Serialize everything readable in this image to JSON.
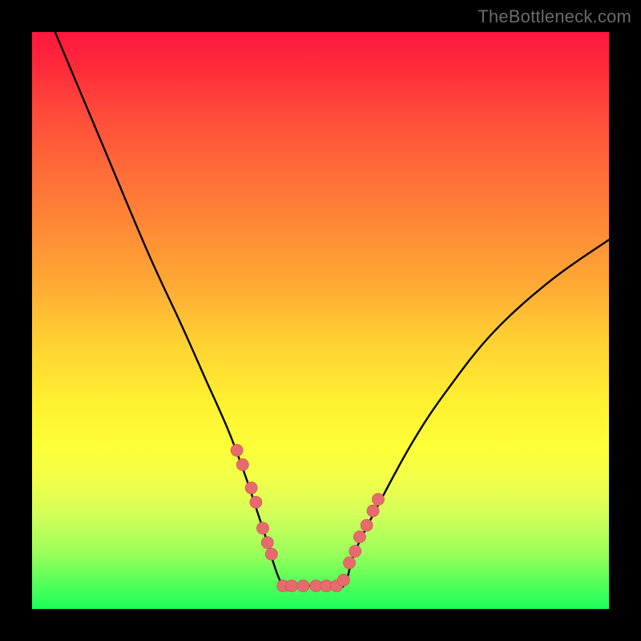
{
  "watermark": "TheBottleneck.com",
  "colors": {
    "frame": "#000000",
    "curve": "#000000",
    "dot_fill": "#e76a6e",
    "dot_stroke": "#c94f53",
    "gradient_top": "#ff173f",
    "gradient_bottom": "#1aff5a"
  },
  "chart_data": {
    "type": "line",
    "title": "",
    "xlabel": "",
    "ylabel": "",
    "xlim": [
      0,
      100
    ],
    "ylim": [
      0,
      100
    ],
    "annotations": [],
    "note": "No numeric axes are shown; x/y are normalized 0–100 within the plot area. y=0 is bottom (green), y=100 is top (red). V-shaped bottleneck curve with flat minimum and scattered dots on the flanks near the trough.",
    "series": [
      {
        "name": "bottleneck-curve",
        "x": [
          4,
          12,
          20,
          26,
          30,
          34,
          37,
          40,
          43.5,
          47,
          51,
          54,
          56,
          60,
          66,
          72,
          80,
          90,
          100
        ],
        "y": [
          100,
          81,
          62,
          49,
          40,
          31,
          23,
          14,
          4,
          4,
          4,
          4,
          10,
          18,
          29,
          38,
          48,
          57,
          64
        ]
      },
      {
        "name": "dots",
        "type": "scatter",
        "x": [
          35.5,
          36.5,
          38,
          38.8,
          40,
          40.8,
          41.5,
          43.5,
          45,
          47,
          49.2,
          51,
          52.8,
          54,
          55,
          56,
          56.8,
          58,
          59.1,
          60
        ],
        "y": [
          27.5,
          25,
          21,
          18.5,
          14,
          11.5,
          9.5,
          4,
          4,
          4,
          4,
          4,
          4,
          5,
          8,
          10,
          12.5,
          14.5,
          17,
          19
        ],
        "r": 1.05
      }
    ]
  }
}
